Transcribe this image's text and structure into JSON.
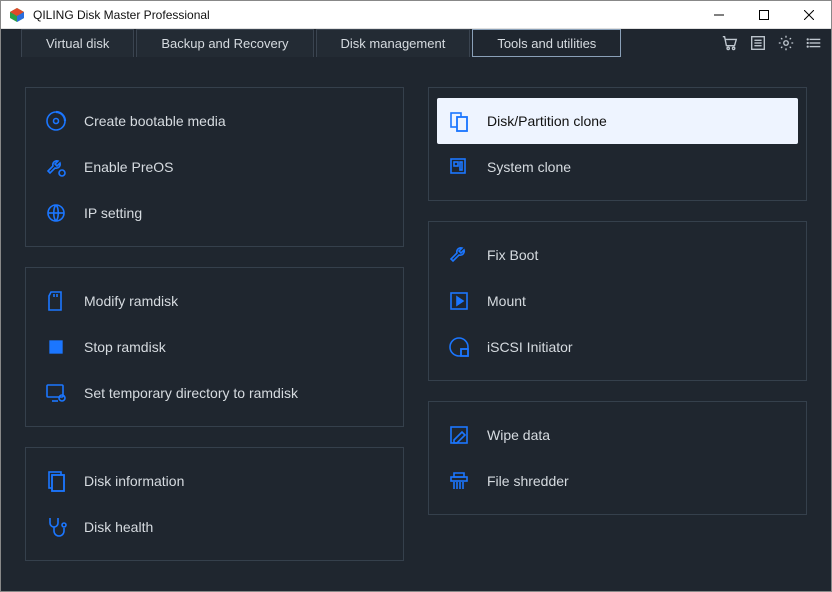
{
  "window": {
    "title": "QILING Disk Master Professional"
  },
  "tabs": [
    {
      "label": "Virtual disk"
    },
    {
      "label": "Backup and Recovery"
    },
    {
      "label": "Disk management"
    },
    {
      "label": "Tools and utilities"
    }
  ],
  "left": {
    "group1": [
      {
        "label": "Create bootable media"
      },
      {
        "label": "Enable PreOS"
      },
      {
        "label": "IP setting"
      }
    ],
    "group2": [
      {
        "label": "Modify ramdisk"
      },
      {
        "label": "Stop ramdisk"
      },
      {
        "label": "Set temporary directory to ramdisk"
      }
    ],
    "group3": [
      {
        "label": "Disk information"
      },
      {
        "label": "Disk health"
      }
    ]
  },
  "right": {
    "group1": [
      {
        "label": "Disk/Partition clone"
      },
      {
        "label": "System clone"
      }
    ],
    "group2": [
      {
        "label": "Fix Boot"
      },
      {
        "label": "Mount"
      },
      {
        "label": "iSCSI Initiator"
      }
    ],
    "group3": [
      {
        "label": "Wipe data"
      },
      {
        "label": "File shredder"
      }
    ]
  },
  "selected_item": "Disk/Partition clone",
  "active_tab": "Tools and utilities"
}
